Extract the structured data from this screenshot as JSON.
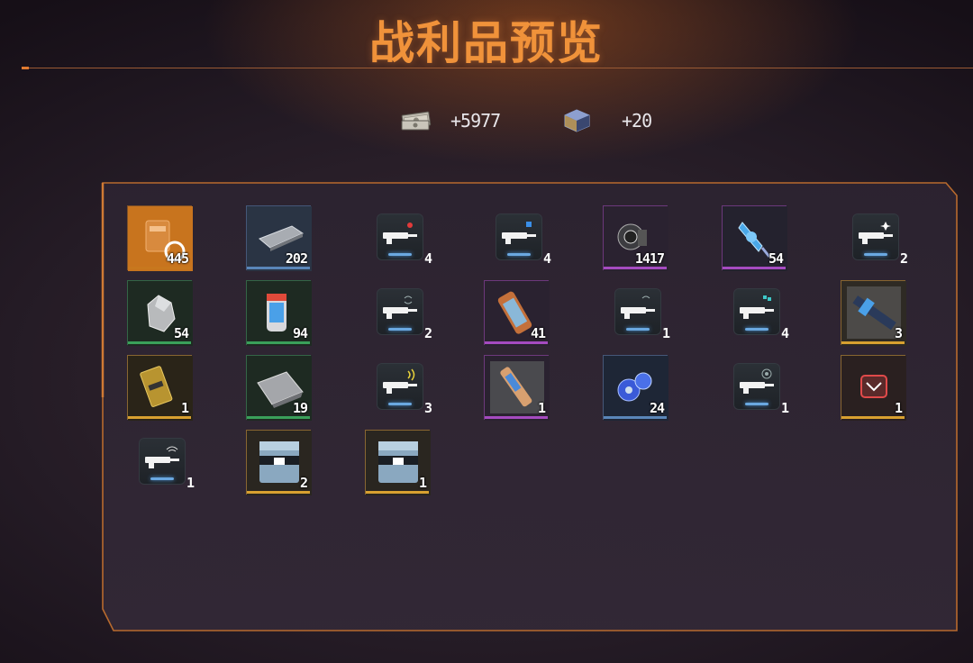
{
  "title": "战利品预览",
  "currencies": [
    {
      "icon": "cash-bundle-icon",
      "value": "+5977"
    },
    {
      "icon": "data-cube-icon",
      "value": "+20"
    }
  ],
  "rarity_colors": {
    "orange": "#c8781e",
    "green": "#3aa05a",
    "blue": "#5a86b8",
    "purple": "#a54bc0",
    "gold": "#d8a030",
    "none": "#3a3d44"
  },
  "items": [
    {
      "icon": "orange-chip-pack-icon",
      "qty": "445",
      "rarity": "orange"
    },
    {
      "icon": "metal-plate-icon",
      "qty": "202",
      "rarity": "blue"
    },
    {
      "icon": "rifle-fire-mod-icon",
      "qty": "4",
      "rarity": "none"
    },
    {
      "icon": "rifle-scope-mod-icon",
      "qty": "4",
      "rarity": "none"
    },
    {
      "icon": "energy-core-icon",
      "qty": "1417",
      "rarity": "purple"
    },
    {
      "icon": "blue-crystal-shard-icon",
      "qty": "54",
      "rarity": "purple"
    },
    {
      "icon": "rifle-spark-mod-icon",
      "qty": "2",
      "rarity": "none"
    },
    {
      "icon": "gray-ore-icon",
      "qty": "54",
      "rarity": "green"
    },
    {
      "icon": "energy-canister-icon",
      "qty": "94",
      "rarity": "green"
    },
    {
      "icon": "assault-rifle-mod-icon",
      "qty": "2",
      "rarity": "none"
    },
    {
      "icon": "copper-cylinder-icon",
      "qty": "41",
      "rarity": "purple"
    },
    {
      "icon": "pistol-mod-icon",
      "qty": "1",
      "rarity": "none"
    },
    {
      "icon": "shotgun-mod-icon",
      "qty": "4",
      "rarity": "none"
    },
    {
      "icon": "weapon-blueprint-icon",
      "qty": "3",
      "rarity": "gold"
    },
    {
      "icon": "gold-keycard-icon",
      "qty": "1",
      "rarity": "gold"
    },
    {
      "icon": "cloth-fabric-icon",
      "qty": "19",
      "rarity": "green"
    },
    {
      "icon": "rifle-wave-mod-icon",
      "qty": "3",
      "rarity": "none"
    },
    {
      "icon": "injector-blueprint-icon",
      "qty": "1",
      "rarity": "purple"
    },
    {
      "icon": "blue-gear-cluster-icon",
      "qty": "24",
      "rarity": "blue"
    },
    {
      "icon": "sniper-radar-mod-icon",
      "qty": "1",
      "rarity": "none"
    },
    {
      "icon": "red-emblem-icon",
      "qty": "1",
      "rarity": "gold"
    },
    {
      "icon": "sniper-wifi-mod-icon",
      "qty": "1",
      "rarity": "none"
    },
    {
      "icon": "supply-crate-icon",
      "qty": "2",
      "rarity": "gold"
    },
    {
      "icon": "supply-crate-icon",
      "qty": "1",
      "rarity": "gold"
    }
  ]
}
